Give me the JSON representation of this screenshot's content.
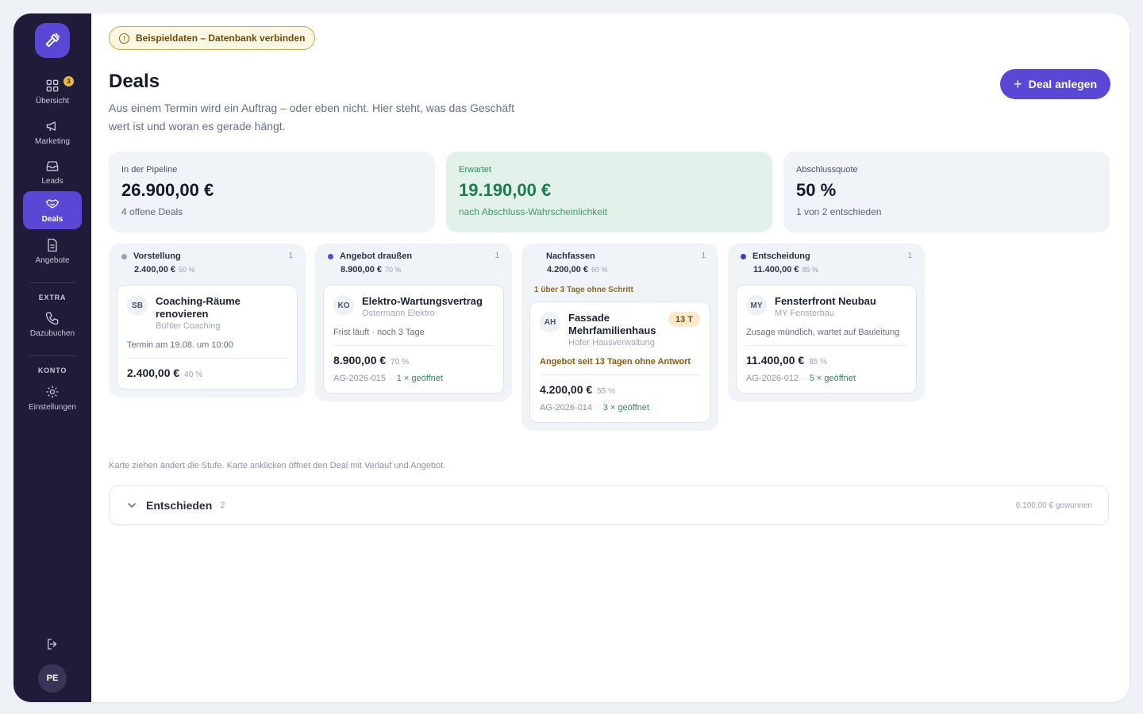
{
  "sidebar": {
    "logo_icon": "hammer-icon",
    "items": [
      {
        "label": "Übersicht",
        "icon": "grid-icon",
        "badge": "3"
      },
      {
        "label": "Marketing",
        "icon": "megaphone-icon"
      },
      {
        "label": "Leads",
        "icon": "inbox-icon"
      },
      {
        "label": "Deals",
        "icon": "handshake-icon",
        "active": true
      },
      {
        "label": "Angebote",
        "icon": "document-icon"
      }
    ],
    "extra_heading": "EXTRA",
    "extra_item": {
      "label": "Dazubuchen",
      "icon": "phone-icon"
    },
    "account_heading": "KONTO",
    "account_item": {
      "label": "Einstellungen",
      "icon": "gear-icon"
    },
    "avatar": "PE"
  },
  "demo_badge": "Beispieldaten – Datenbank verbinden",
  "page": {
    "title": "Deals",
    "description": "Aus einem Termin wird ein Auftrag – oder eben nicht. Hier steht, was das Geschäft wert ist und woran es gerade hängt.",
    "primary_button": "Deal anlegen"
  },
  "stats": [
    {
      "label": "In der Pipeline",
      "value": "26.900,00 €",
      "sub": "4 offene Deals"
    },
    {
      "label": "Erwartet",
      "value": "19.190,00 €",
      "sub": "nach Abschluss-Wahrscheinlichkeit"
    },
    {
      "label": "Abschlussquote",
      "value": "50 %",
      "sub": "1 von 2 entschieden"
    }
  ],
  "columns": [
    {
      "title": "Vorstellung",
      "count": "1",
      "sum": "2.400,00 €",
      "pct": "50 %",
      "dot": "#9aa3b5",
      "card": {
        "initials": "SB",
        "title": "Coaching-Räume renovieren",
        "company": "Bühler Coaching",
        "note": "Termin am 19.08. um 10:00",
        "amount": "2.400,00 €",
        "pct": "40 %"
      }
    },
    {
      "title": "Angebot draußen",
      "count": "1",
      "sum": "8.900,00 €",
      "pct": "70 %",
      "dot": "#5b47d6",
      "card": {
        "initials": "KO",
        "title": "Elektro-Wartungsvertrag",
        "company": "Ostermann Elektro",
        "note": "Frist läuft · noch 3 Tage",
        "amount": "8.900,00 €",
        "pct": "70 %",
        "ref": "AG-2026-015",
        "opened": "1 × geöffnet"
      }
    },
    {
      "title": "Nachfassen",
      "count": "1",
      "sum": "4.200,00 €",
      "pct": "60 %",
      "dot": "",
      "warning": "1 über 3 Tage ohne Schritt",
      "card": {
        "initials": "AH",
        "title": "Fassade Mehrfamilienhaus",
        "company": "Hofer Hausverwaltung",
        "age": "13 T",
        "note": "Angebot seit 13 Tagen ohne Antwort",
        "amount": "4.200,00 €",
        "pct": "55 %",
        "ref": "AG-2026-014",
        "opened": "3 × geöffnet"
      }
    },
    {
      "title": "Entscheidung",
      "count": "1",
      "sum": "11.400,00 €",
      "pct": "85 %",
      "dot": "#4a38b8",
      "card": {
        "initials": "MY",
        "title": "Fensterfront Neubau",
        "company": "MY Fensterbau",
        "note": "Zusage mündlich, wartet auf Bauleitung",
        "amount": "11.400,00 €",
        "pct": "85 %",
        "ref": "AG-2026-012",
        "opened": "5 × geöffnet"
      }
    }
  ],
  "hint": "Karte ziehen ändert die Stufe. Karte anklicken öffnet den Deal mit Verlauf und Angebot.",
  "decided": {
    "title": "Entschieden",
    "count": "2",
    "won": "6.100,00 € gewonnen"
  },
  "colors": {
    "accent": "#5b47d6",
    "sidebar": "#1f1b38",
    "success": "#1e7a52",
    "warning": "#8a6a1c"
  }
}
